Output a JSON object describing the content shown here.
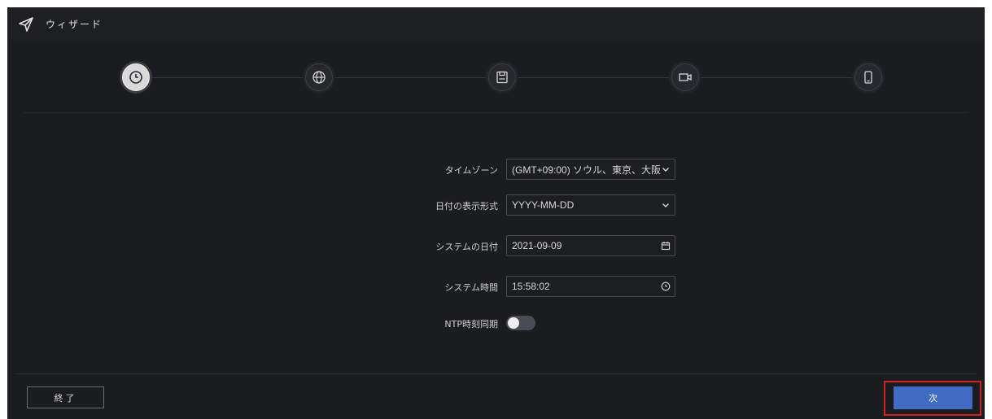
{
  "window": {
    "title": "ウィザード",
    "icon": "paper-plane-icon"
  },
  "steps": [
    {
      "icon": "clock-icon",
      "active": true
    },
    {
      "icon": "globe-icon",
      "active": false
    },
    {
      "icon": "save-icon",
      "active": false
    },
    {
      "icon": "camera-icon",
      "active": false
    },
    {
      "icon": "mobile-icon",
      "active": false
    }
  ],
  "form": {
    "timezone": {
      "label": "タイムゾーン",
      "value": "(GMT+09:00) ソウル、東京、大阪",
      "icon": "chevron-down-icon"
    },
    "date_format": {
      "label": "日付の表示形式",
      "value": "YYYY-MM-DD",
      "icon": "chevron-down-icon"
    },
    "system_date": {
      "label": "システムの日付",
      "value": "2021-09-09",
      "icon": "calendar-icon"
    },
    "system_time": {
      "label": "システム時間",
      "value": "15:58:02",
      "icon": "clock-icon"
    },
    "ntp": {
      "label": "NTP時刻同期",
      "enabled": false
    }
  },
  "footer": {
    "exit_label": "終了",
    "next_label": "次"
  },
  "colors": {
    "accent": "#3f6bc3",
    "background": "#1b1c20",
    "highlight": "#d42020"
  }
}
